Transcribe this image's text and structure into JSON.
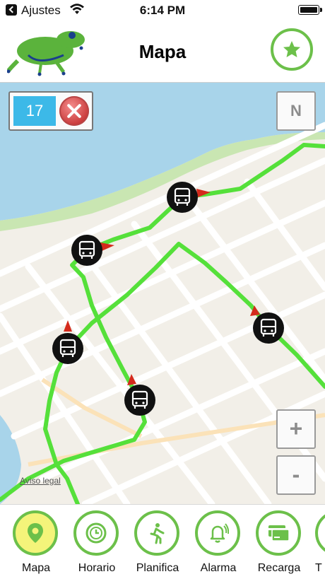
{
  "status": {
    "carrier": "Ajustes",
    "time": "6:14 PM"
  },
  "nav": {
    "title": "Mapa",
    "favorite_icon": "star-icon"
  },
  "stop": {
    "number": "17"
  },
  "map": {
    "compass_label": "N",
    "zoom_in_label": "+",
    "zoom_out_label": "-",
    "legal_label": "Aviso legal"
  },
  "tabs": [
    {
      "label": "Mapa",
      "icon": "map-pin-icon",
      "active": true
    },
    {
      "label": "Horario",
      "icon": "clock-icon",
      "active": false
    },
    {
      "label": "Planifica",
      "icon": "walking-person-icon",
      "active": false
    },
    {
      "label": "Alarma",
      "icon": "bell-icon",
      "active": false
    },
    {
      "label": "Recarga",
      "icon": "card-icon",
      "active": false
    },
    {
      "label": "T",
      "icon": "more-icon",
      "active": false
    }
  ],
  "colors": {
    "accent": "#6cc04a",
    "route": "#55e03a",
    "stop_badge": "#3cb9e8",
    "water": "#a8d4ea"
  }
}
